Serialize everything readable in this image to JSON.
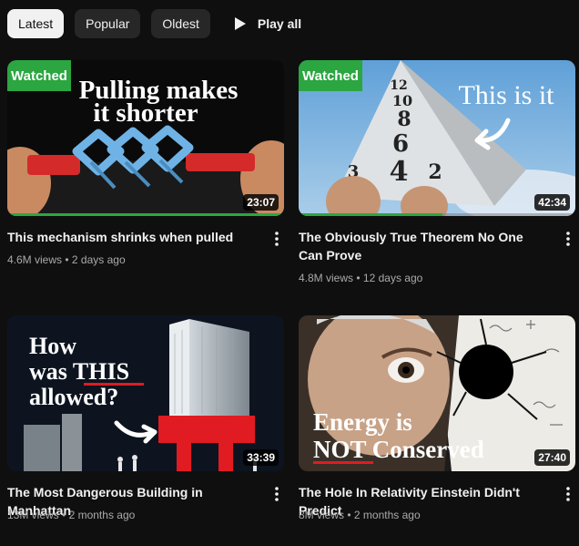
{
  "filters": {
    "latest": "Latest",
    "popular": "Popular",
    "oldest": "Oldest",
    "play_all": "Play all"
  },
  "videos": [
    {
      "title": "This mechanism shrinks when pulled",
      "views": "4.6M views",
      "age": "2 days ago",
      "duration": "23:07",
      "watched": "Watched",
      "progress": 1.0,
      "thumb_text": [
        "Pulling makes",
        "it shorter"
      ]
    },
    {
      "title": "The Obviously True Theorem No One Can Prove",
      "views": "4.8M views",
      "age": "12 days ago",
      "duration": "42:34",
      "watched": "Watched",
      "progress": 0.52,
      "thumb_text": [
        "This is it"
      ]
    },
    {
      "title": "The Most Dangerous Building in Manhattan",
      "views": "13M views",
      "age": "2 months ago",
      "duration": "33:39",
      "thumb_text": [
        "How",
        "was THIS",
        "allowed?"
      ]
    },
    {
      "title": "The Hole In Relativity Einstein Didn't Predict",
      "views": "8M views",
      "age": "2 months ago",
      "duration": "27:40",
      "thumb_text": [
        "Energy is",
        "NOT Conserved"
      ]
    }
  ],
  "meta_separator": "•",
  "colors": {
    "watched_badge": "#2ba640",
    "background": "#0f0f0f",
    "chip": "#272727"
  }
}
